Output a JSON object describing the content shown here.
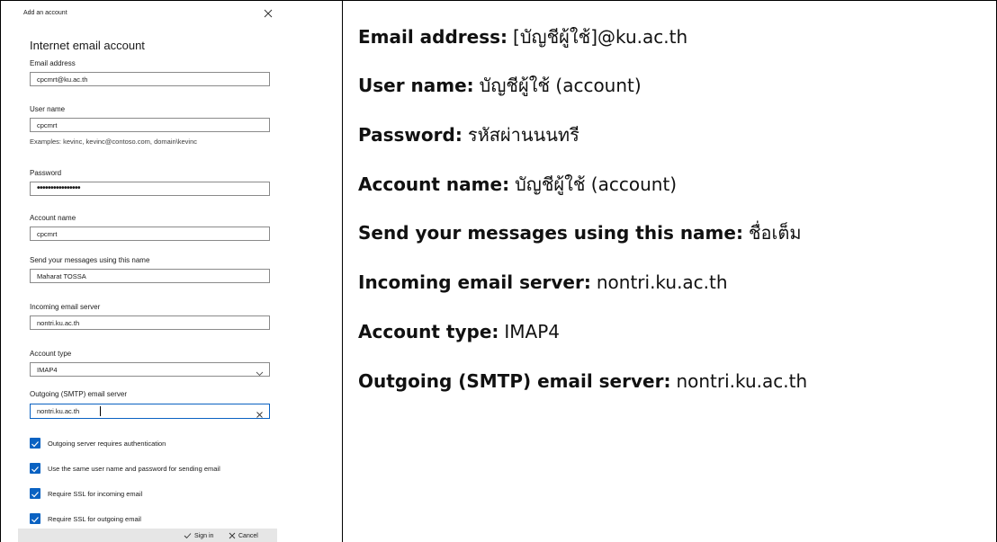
{
  "dialog": {
    "title": "Add an account",
    "heading": "Internet email account",
    "fields": {
      "email": {
        "label": "Email address",
        "value": "cpcmrt@ku.ac.th"
      },
      "username": {
        "label": "User name",
        "value": "cpcmrt",
        "hint": "Examples: kevinc, kevinc@contoso.com, domain\\kevinc"
      },
      "password": {
        "label": "Password",
        "value": "••••••••••••••••"
      },
      "account_name": {
        "label": "Account name",
        "value": "cpcmrt"
      },
      "send_name": {
        "label": "Send your messages using this name",
        "value": "Maharat TOSSA"
      },
      "incoming_server": {
        "label": "Incoming email server",
        "value": "nontri.ku.ac.th"
      },
      "account_type": {
        "label": "Account type",
        "value": "IMAP4"
      },
      "outgoing_server": {
        "label": "Outgoing (SMTP) email server",
        "value": "nontri.ku.ac.th"
      }
    },
    "checks": [
      {
        "label": "Outgoing server requires authentication",
        "checked": true
      },
      {
        "label": "Use the same user name and password for sending email",
        "checked": true
      },
      {
        "label": "Require SSL for incoming email",
        "checked": true
      },
      {
        "label": "Require SSL for outgoing email",
        "checked": true
      }
    ],
    "footer": {
      "sign_in": "Sign in",
      "cancel": "Cancel"
    }
  },
  "info": [
    {
      "key": "Email address:",
      "value": "[บัญชีผู้ใช้]@ku.ac.th"
    },
    {
      "key": "User name:",
      "value": "บัญชีผู้ใช้ (account)"
    },
    {
      "key": "Password:",
      "value": "รหัสผ่านนนทรี"
    },
    {
      "key": "Account name:",
      "value": "บัญชีผู้ใช้ (account)"
    },
    {
      "key": "Send your messages using this name:",
      "value": "ชื่อเต็ม"
    },
    {
      "key": "Incoming email server:",
      "value": "nontri.ku.ac.th"
    },
    {
      "key": "Account type:",
      "value": "IMAP4"
    },
    {
      "key": "Outgoing (SMTP) email server:",
      "value": "nontri.ku.ac.th"
    }
  ],
  "colors": {
    "accent": "#0a62c2",
    "footer_bg": "#e6e6e6"
  }
}
